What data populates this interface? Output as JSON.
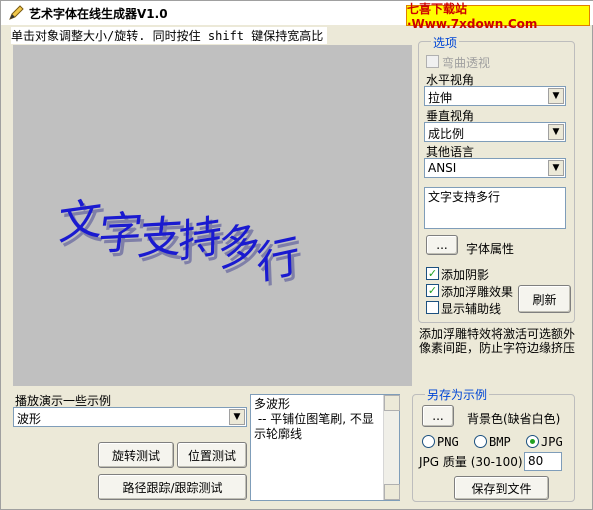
{
  "window": {
    "title": "艺术字体在线生成器V1.0",
    "watermark": "七喜下载站·Www.7xdown.Com"
  },
  "hint": "单击对象调整大小/旋转.  同时按住 shift 键保持宽高比",
  "canvas": {
    "text": "文字支持多行",
    "text_color": "#1a1ad0",
    "shadow_color": "#7f7fa8"
  },
  "options": {
    "group_title": "选项",
    "curve_perspective": "弯曲透视",
    "h_view_label": "水平视角",
    "h_view_value": "拉伸",
    "v_view_label": "垂直视角",
    "v_view_value": "成比例",
    "lang_label": "其他语言",
    "lang_value": "ANSI",
    "text_content": "文字支持多行",
    "dots_label": "...",
    "font_props": "字体属性",
    "add_shadow": "添加阴影",
    "add_emboss": "添加浮雕效果",
    "show_guides": "显示辅助线",
    "refresh": "刷新",
    "note": "添加浮雕特效将激活可选额外像素间距，防止字符边缘挤压"
  },
  "demo": {
    "label": "播放演示一些示例",
    "value": "波形",
    "desc": "多波形\n -- 平铺位图笔刷, 不显示轮廓线",
    "rotate_test": "旋转测试",
    "position_test": "位置测试",
    "path_test": "路径跟踪/跟踪测试"
  },
  "saveas": {
    "group_title": "另存为示例",
    "dots_label": "...",
    "bg_color": "背景色(缺省白色)",
    "png": "PNG",
    "bmp": "BMP",
    "jpg": "JPG",
    "jpg_quality_label": "JPG 质量 (30-100)",
    "jpg_quality": "80",
    "save_file": "保存到文件"
  },
  "icons": {
    "app": "pencil-icon",
    "dropdown": "chevron-down-icon"
  },
  "colors": {
    "window_bg": "#ece9d8",
    "watermark_bg": "#ffff00",
    "watermark_fg": "#cc0000",
    "group_title": "#0046d5",
    "check_mark": "#21a121"
  }
}
